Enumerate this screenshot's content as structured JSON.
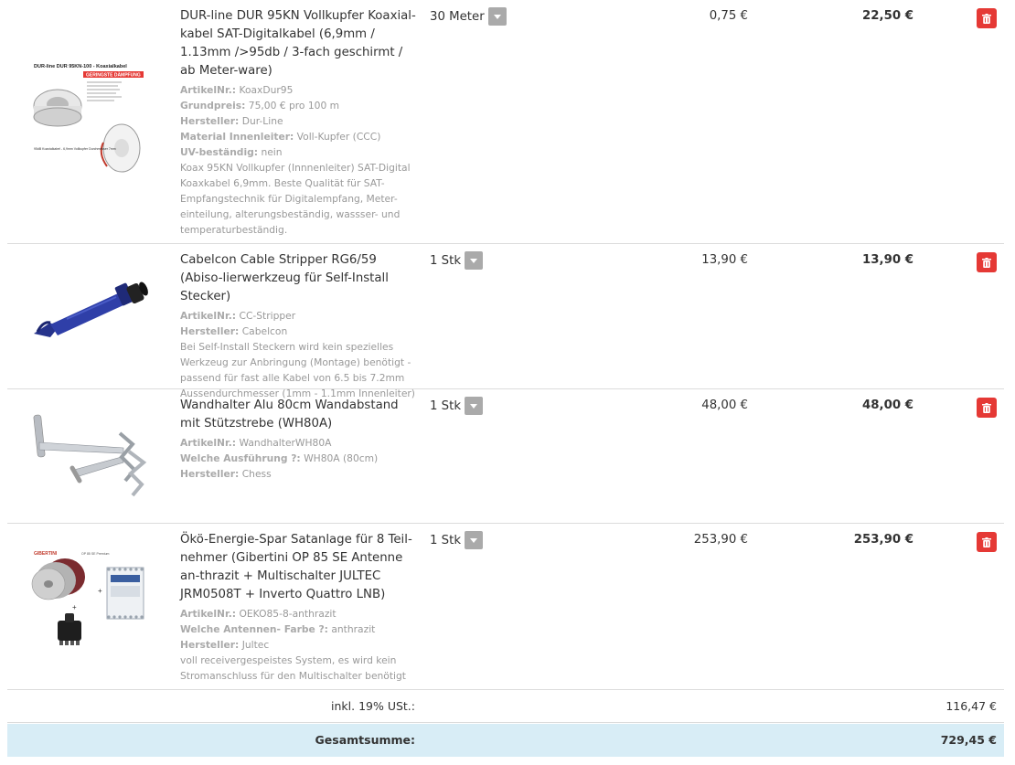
{
  "items": [
    {
      "title": "DUR-line DUR 95KN Vollkupfer Koaxial-kabel SAT-Digitalkabel (6,9mm / 1.13mm />95db / 3-fach geschirmt / ab Meter-ware)",
      "attrs": [
        {
          "key": "ArtikelNr.:",
          "value": "KoaxDur95"
        },
        {
          "key": "Grundpreis:",
          "value": "75,00 € pro 100 m"
        },
        {
          "key": "Hersteller:",
          "value": "Dur-Line"
        },
        {
          "key": "Material Innenleiter:",
          "value": "Voll-Kupfer (CCC)"
        },
        {
          "key": "UV-beständig:",
          "value": "nein"
        }
      ],
      "note": "Koax 95KN Vollkupfer (Innnenleiter) SAT-Digital Koaxkabel 6,9mm. Beste Qualität für SAT-Empfangstechnik für Digitalempfang, Meter-einteilung, alterungsbeständig, wassser- und temperaturbeständig.",
      "image": {
        "header": "DUR-line DUR 95KN-100 - Koaxialkabel",
        "banner": "GERINGSTE DÄMPFUNG",
        "footer": "95dB Koaxialkabel - 6,9mm Vollkupfer Durchmesser 7mm"
      },
      "qty": "30 Meter",
      "unit_price": "0,75 €",
      "total": "22,50 €"
    },
    {
      "title": "Cabelcon Cable Stripper RG6/59 (Abiso-lierwerkzeug für Self-Install Stecker)",
      "attrs": [
        {
          "key": "ArtikelNr.:",
          "value": "CC-Stripper"
        },
        {
          "key": "Hersteller:",
          "value": "Cabelcon"
        }
      ],
      "note": "Bei Self-Install Steckern wird kein spezielles Werkzeug zur Anbringung (Montage) benötigt - passend für fast alle Kabel von 6.5 bis 7.2mm Aussendurchmesser (1mm - 1.1mm Innenleiter)",
      "qty": "1 Stk",
      "unit_price": "13,90 €",
      "total": "13,90 €"
    },
    {
      "title": "Wandhalter Alu 80cm Wandabstand mit Stützstrebe (WH80A)",
      "attrs": [
        {
          "key": "ArtikelNr.:",
          "value": "WandhalterWH80A"
        },
        {
          "key": "Welche Ausführung ?:",
          "value": "WH80A (80cm)"
        },
        {
          "key": "Hersteller:",
          "value": "Chess"
        }
      ],
      "note": "",
      "qty": "1 Stk",
      "unit_price": "48,00 €",
      "total": "48,00 €"
    },
    {
      "title": "Ökö-Energie-Spar Satanlage für 8 Teil-nehmer (Gibertini OP 85 SE Antenne an-thrazit + Multischalter JULTEC JRM0508T + Inverto Quattro LNB)",
      "attrs": [
        {
          "key": "ArtikelNr.:",
          "value": "OEKO85-8-anthrazit"
        },
        {
          "key": "Welche Antennen- Farbe ?:",
          "value": "anthrazit"
        },
        {
          "key": "Hersteller:",
          "value": "Jultec"
        }
      ],
      "note": "voll receivergespeistes System, es wird kein Stromanschluss für den Multischalter benötigt",
      "image": {
        "brand": "GIBERTINI",
        "model": "OP 85 SE Premium"
      },
      "qty": "1 Stk",
      "unit_price": "253,90 €",
      "total": "253,90 €"
    }
  ],
  "summary": {
    "tax_label": "inkl. 19% USt.:",
    "tax_value": "116,47 €",
    "total_label": "Gesamtsumme:",
    "total_value": "729,45 €"
  },
  "colors": {
    "delete_button": "#e53935",
    "qty_button": "#aaaaaa",
    "total_row_bg": "#d8edf6"
  },
  "icons": {
    "qty_button": "caret-down-icon",
    "delete_button": "trash-icon"
  }
}
